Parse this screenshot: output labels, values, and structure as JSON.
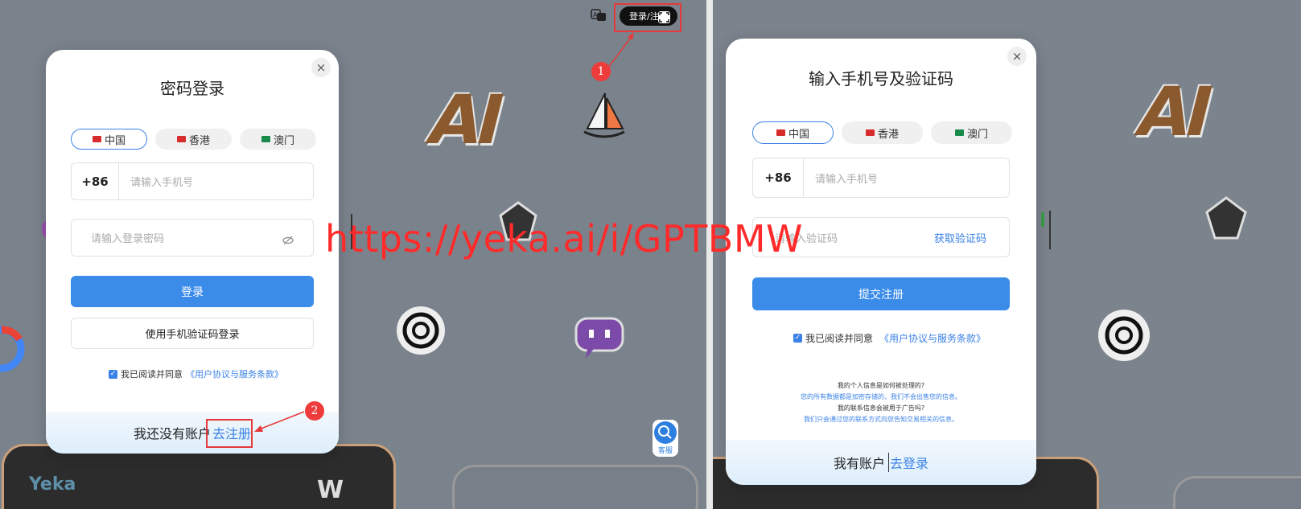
{
  "left": {
    "title": "密码登录",
    "close": "×",
    "tabs": [
      {
        "label": "中国",
        "flag_color": "#d62c2c"
      },
      {
        "label": "香港",
        "flag_color": "#d62c2c"
      },
      {
        "label": "澳门",
        "flag_color": "#1a8a4a"
      }
    ],
    "country_code": "+86",
    "phone_placeholder": "请输入手机号",
    "password_placeholder": "请输入登录密码",
    "eye_icon": "eye-off-icon",
    "login_button": "登录",
    "sms_login_button": "使用手机验证码登录",
    "agree_text": "我已阅读并同意",
    "agree_link": "《用户协议与服务条款》",
    "footer_text": "我还没有账户",
    "footer_link": "去注册"
  },
  "right": {
    "title": "输入手机号及验证码",
    "close": "×",
    "tabs": [
      {
        "label": "中国",
        "flag_color": "#d62c2c"
      },
      {
        "label": "香港",
        "flag_color": "#d62c2c"
      },
      {
        "label": "澳门",
        "flag_color": "#1a8a4a"
      }
    ],
    "country_code": "+86",
    "phone_placeholder": "请输入手机号",
    "code_placeholder": "请输入验证码",
    "get_code": "获取验证码",
    "submit_button": "提交注册",
    "agree_text": "我已阅读并同意",
    "agree_link": "《用户协议与服务条款》",
    "faq": [
      {
        "q": "我的个人信息是如何被处理的?",
        "a": "您的所有数据都是加密存储的，我们不会出售您的信息。"
      },
      {
        "q": "我的联系信息会被用于广告吗?",
        "a": "我们只会通过您的联系方式向您告知交易相关的信息。"
      }
    ],
    "footer_text": "我有账户",
    "footer_link": "去登录"
  },
  "header": {
    "login_register_button": "登录/注",
    "translate_icon": "translate-icon"
  },
  "side_widget": {
    "label": "客服",
    "icon": "search-icon"
  },
  "annotations": {
    "badge1": "1",
    "badge2": "2"
  },
  "watermark": "https://yeka.ai/i/GPTBMW",
  "bottom_card_label": "Yeka",
  "accent_color": "#3b8be8",
  "annotation_color": "#e63a3a"
}
